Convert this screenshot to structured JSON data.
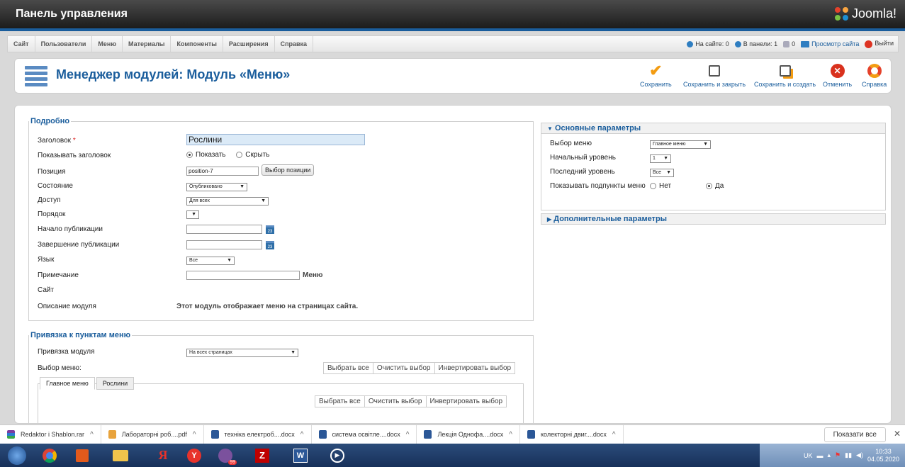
{
  "app": {
    "title": "Панель управления",
    "logo": "Joomla!"
  },
  "menu": [
    "Сайт",
    "Пользователи",
    "Меню",
    "Материалы",
    "Компоненты",
    "Расширения",
    "Справка"
  ],
  "status": {
    "on_site": "На сайте: 0",
    "in_panel": "В панели: 1",
    "messages": "0",
    "view_site": "Просмотр сайта",
    "logout": "Выйти"
  },
  "toolbar": {
    "title": "Менеджер модулей: Модуль «Меню»",
    "buttons": [
      "Сохранить",
      "Сохранить и закрыть",
      "Сохранить и создать",
      "Отменить",
      "Справка"
    ]
  },
  "details": {
    "legend": "Подробно",
    "title_label": "Заголовок",
    "required": "*",
    "title_value": "Рослини",
    "show_title_label": "Показывать заголовок",
    "show": "Показать",
    "hide": "Скрыть",
    "position_label": "Позиция",
    "position_value": "position-7",
    "position_button": "Выбор позиции",
    "state_label": "Состояние",
    "state_value": "Опубликовано",
    "access_label": "Доступ",
    "access_value": "Для всех",
    "ordering_label": "Порядок",
    "publish_up_label": "Начало публикации",
    "publish_down_label": "Завершение публикации",
    "calendar_icon": "23",
    "language_label": "Язык",
    "language_value": "Все",
    "note_label": "Примечание",
    "note_suffix": "Меню",
    "site_label": "Сайт",
    "desc_label": "Описание модуля",
    "desc_value": "Этот модуль отображает меню на страницах сайта."
  },
  "assignment": {
    "legend": "Привязка к пунктам меню",
    "module_assign_label": "Привязка модуля",
    "module_assign_value": "На всех страницах",
    "menu_select_label": "Выбор меню:",
    "buttons": [
      "Выбрать все",
      "Очистить выбор",
      "Инвертировать выбор"
    ],
    "tabs": [
      "Главное меню",
      "Рослини"
    ]
  },
  "basic": {
    "title": "Основные параметры",
    "menu_label": "Выбор меню",
    "menu_value": "Главное меню",
    "start_label": "Начальный уровень",
    "start_value": "1",
    "end_label": "Последний уровень",
    "end_value": "Все",
    "sub_label": "Показывать подпункты меню",
    "no": "Нет",
    "yes": "Да"
  },
  "advanced": {
    "title": "Дополнительные параметры"
  },
  "downloads": {
    "items": [
      "Redaktor i Shablon.rar",
      "Лабораторні роб....pdf",
      "техніка електроб....docx",
      "система освітле....docx",
      "Лекція  Однофа....docx",
      "колекторні двиг....docx"
    ],
    "show_all": "Показати все"
  },
  "taskbar": {
    "lang": "UK",
    "time": "10:33",
    "date": "04.05.2020",
    "badge": "99"
  }
}
